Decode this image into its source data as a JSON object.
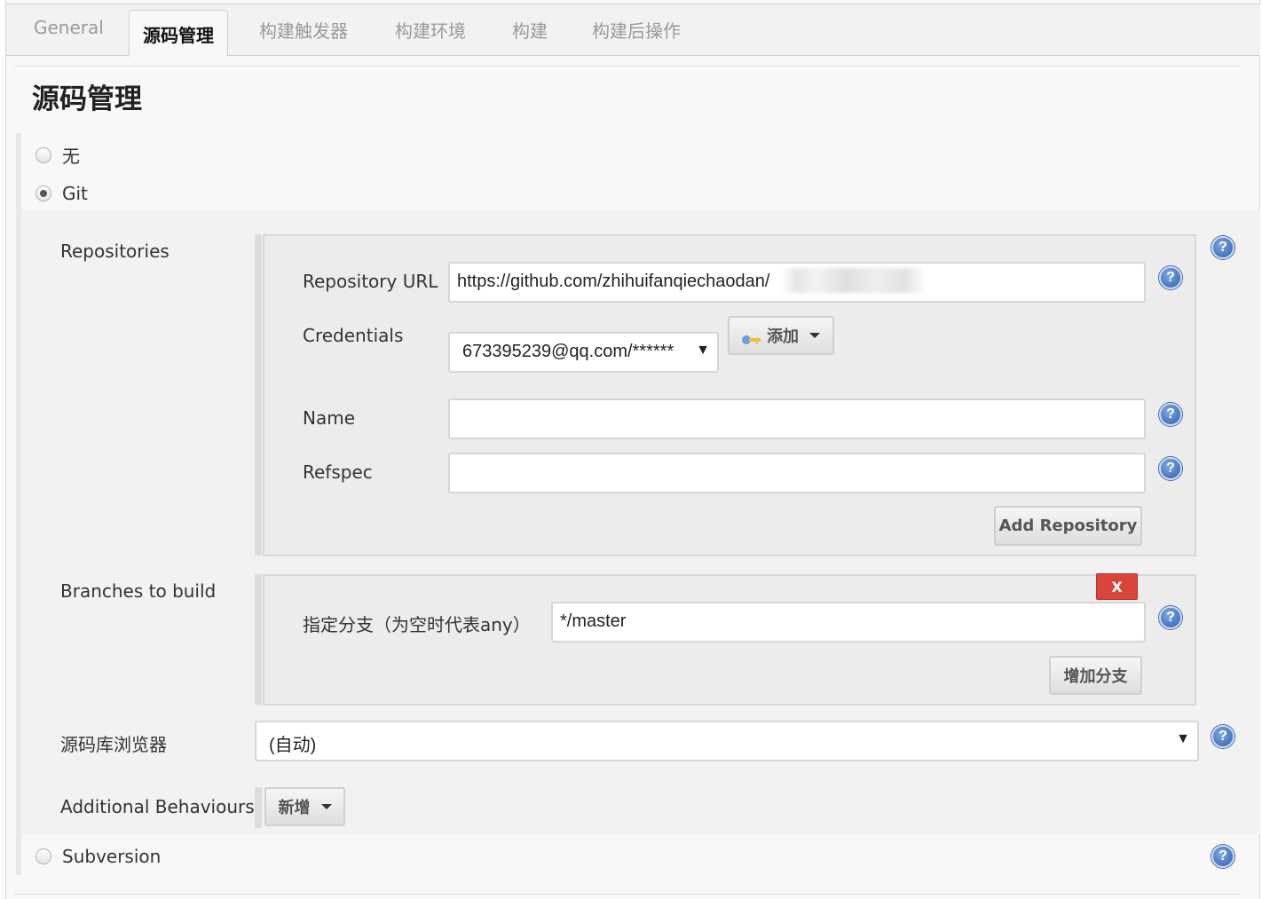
{
  "tabs": [
    {
      "label": "General"
    },
    {
      "label": "源码管理"
    },
    {
      "label": "构建触发器"
    },
    {
      "label": "构建环境"
    },
    {
      "label": "构建"
    },
    {
      "label": "构建后操作"
    }
  ],
  "section_title": "源码管理",
  "scm_options": {
    "none": "无",
    "git": "Git",
    "subversion": "Subversion"
  },
  "repositories": {
    "label": "Repositories",
    "url_label": "Repository URL",
    "url_value": "https://github.com/zhihuifanqiechaodan/",
    "credentials_label": "Credentials",
    "credentials_value": "673395239@qq.com/******",
    "add_credentials_button": "添加",
    "name_label": "Name",
    "name_value": "",
    "refspec_label": "Refspec",
    "refspec_value": "",
    "add_repository_button": "Add Repository"
  },
  "branches": {
    "label": "Branches to build",
    "branch_spec_label": "指定分支（为空时代表any）",
    "branch_spec_value": "*/master",
    "delete_button": "X",
    "add_branch_button": "增加分支"
  },
  "browser": {
    "label": "源码库浏览器",
    "value": "(自动)"
  },
  "behaviours": {
    "label": "Additional Behaviours",
    "add_button": "新增"
  },
  "help_glyph": "?",
  "icons": [
    "key-icon",
    "help-icon",
    "dropdown-arrow-icon"
  ]
}
